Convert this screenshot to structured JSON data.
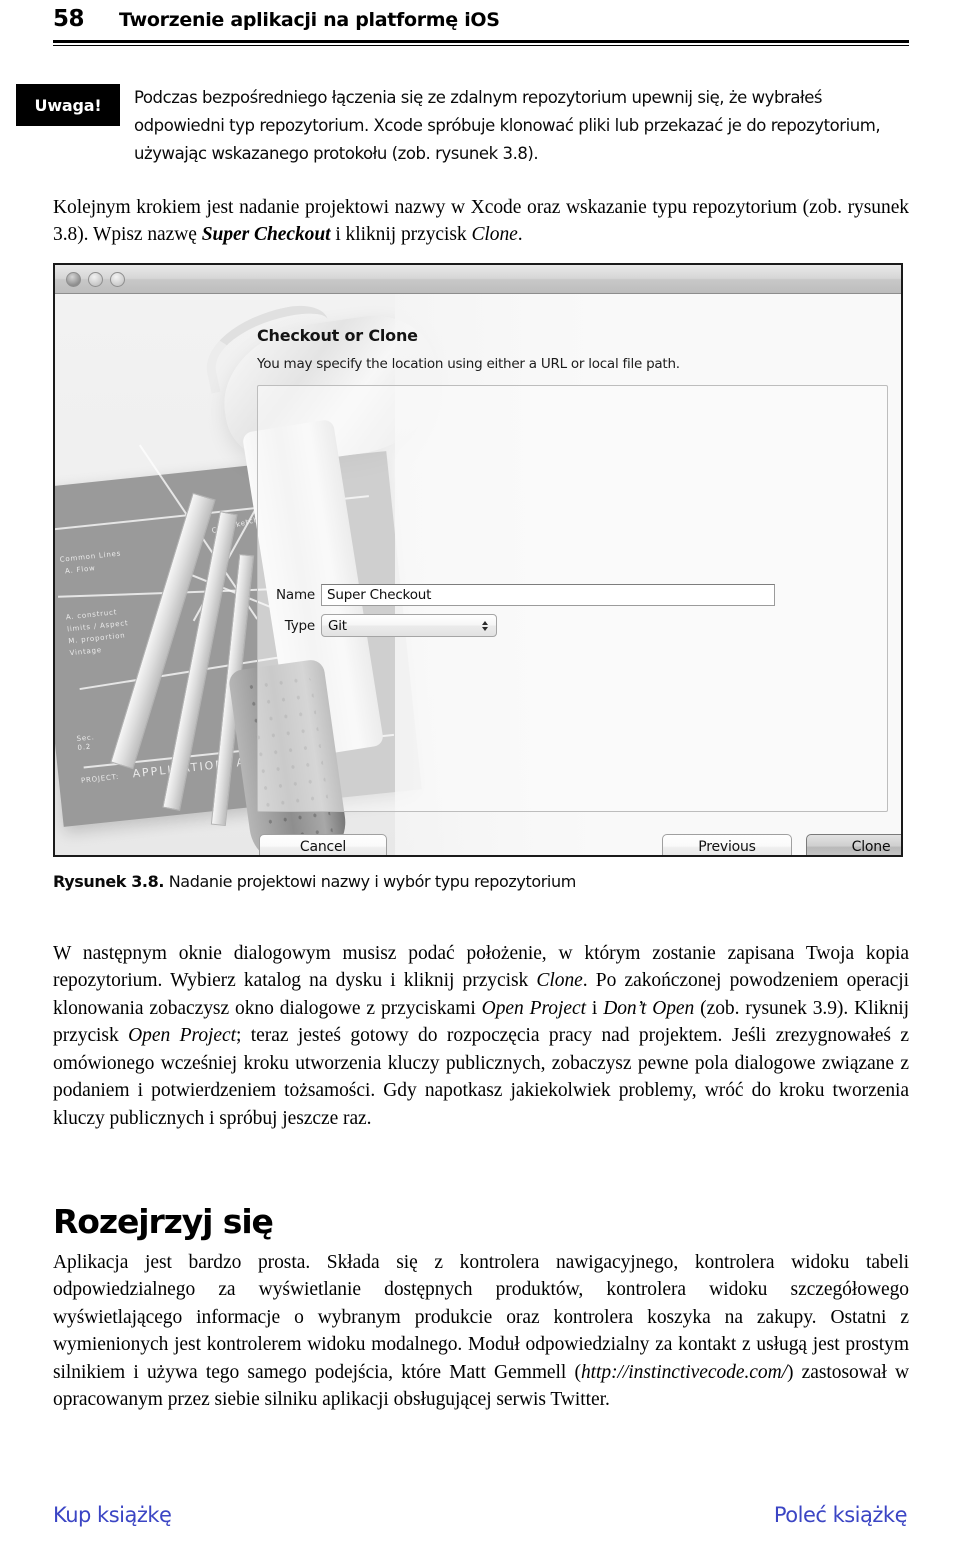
{
  "header": {
    "page_number": "58",
    "title": "Tworzenie aplikacji na platformę iOS"
  },
  "note": {
    "tag_label": "Uwaga!",
    "text": "Podczas bezpośredniego łączenia się ze zdalnym repozytorium upewnij się, że wybrałeś odpowiedni typ repozytorium. Xcode spróbuje klonować pliki lub przekazać je do repozytorium, używając wskazanego protokołu (zob. rysunek 3.8)."
  },
  "paragraphs": {
    "intro_part1": "Kolejnym krokiem jest nadanie projektowi nazwy w Xcode oraz wskazanie typu repozytorium (zob. rysunek 3.8). Wpisz nazwę ",
    "intro_bolditalic": "Super Checkout",
    "intro_part2": " i kliknij przycisk ",
    "intro_italic": "Clone",
    "intro_part3": ".",
    "after_figure_1": "W następnym oknie dialogowym musisz podać położenie, w którym zostanie zapisana Twoja kopia repozytorium. Wybierz katalog na dysku i kliknij przycisk ",
    "after_figure_i1": "Clone",
    "after_figure_2": ". Po zakończonej powodzeniem operacji klonowania zobaczysz okno dialogowe z przyciskami ",
    "after_figure_i2": "Open Project",
    "after_figure_3": " i ",
    "after_figure_i3": "Don’t Open",
    "after_figure_4": " (zob. rysunek 3.9). Kliknij przycisk ",
    "after_figure_i4": "Open Project",
    "after_figure_5": "; teraz jesteś gotowy do rozpoczęcia pracy nad projektem. Jeśli zrezygnowałeś z omówionego wcześniej kroku utworzenia kluczy publicznych, zobaczysz pewne pola dialogowe związane z podaniem i potwierdzeniem tożsamości. Gdy napotkasz jakiekolwiek problemy, wróć do kroku tworzenia kluczy publicznych i spróbuj jeszcze raz.",
    "last_1": "Aplikacja jest bardzo prosta. Składa się z kontrolera nawigacyjnego, kontrolera widoku tabeli odpowiedzialnego za wyświetlanie dostępnych produktów, kontrolera widoku szczegółowego wyświetlającego informacje o wybranym produkcie oraz kontrolera koszyka na zakupy. Ostatni z wymienionych jest kontrolerem widoku modalnego. Moduł odpowiedzialny za kontakt z usługą jest prostym silnikiem i używa tego samego podejścia, które Matt Gemmell (",
    "last_link": "http://instinctivecode.com/",
    "last_2": ") zastosował w opracowanym przez siebie silniku aplikacji obsługującej serwis Twitter."
  },
  "section": {
    "heading": "Rozejrzyj się"
  },
  "figure": {
    "caption_label": "Rysunek 3.8.",
    "caption_text": " Nadanie projektowi nazwy i wybór typu repozytorium",
    "dialog": {
      "title": "Checkout or Clone",
      "subtitle": "You may specify the location using either a URL or local file path.",
      "fields": [
        {
          "label": "Name",
          "value": "Super Checkout",
          "kind": "text"
        },
        {
          "label": "Type",
          "value": "Git",
          "kind": "popup"
        }
      ],
      "buttons": {
        "cancel": "Cancel",
        "previous": "Previous",
        "clone": "Clone"
      },
      "blueprint_text_1": "PROJECT:",
      "blueprint_text_2": "APPLICATION. APP"
    }
  },
  "footer": {
    "left_link": "Kup książkę",
    "right_link": "Poleć książkę",
    "link_color": "#3b45c4"
  },
  "colors": {
    "note_bg": "#000000",
    "note_fg": "#ffffff",
    "text": "#000000",
    "rule": "#000000",
    "figure_border": "#1a1a1a"
  }
}
